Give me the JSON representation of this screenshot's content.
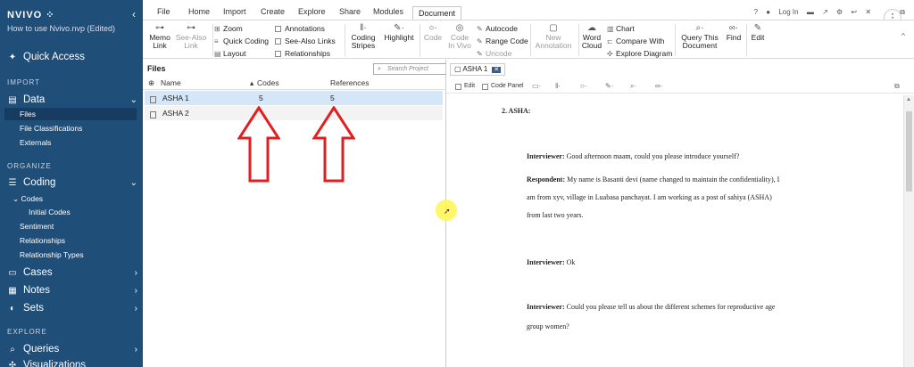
{
  "sidebar": {
    "brand": "NVIVO",
    "file_name": "How to use Nvivo.nvp (Edited)",
    "quick_access": "Quick Access",
    "sections": {
      "import": "IMPORT",
      "organize": "ORGANIZE",
      "explore": "EXPLORE"
    },
    "data_label": "Data",
    "data_items": [
      "Files",
      "File Classifications",
      "Externals"
    ],
    "coding_label": "Coding",
    "codes_label": "Codes",
    "initial_codes": "Initial Codes",
    "coding_items": [
      "Sentiment",
      "Relationships",
      "Relationship Types"
    ],
    "cases_label": "Cases",
    "notes_label": "Notes",
    "sets_label": "Sets",
    "queries_label": "Queries",
    "visualizations_label": "Visualizations"
  },
  "ribbon": {
    "tabs": [
      "File",
      "Home",
      "Import",
      "Create",
      "Explore",
      "Share",
      "Modules",
      "Document"
    ],
    "active_tab": "Document",
    "login": "Log In",
    "memo_link": [
      "Memo",
      "Link"
    ],
    "see_also_link": [
      "See-Also",
      "Link"
    ],
    "zoom": "Zoom",
    "quick_coding": "Quick Coding",
    "layout": "Layout",
    "annotations": "Annotations",
    "see_also_links": "See-Also Links",
    "relationships": "Relationships",
    "coding_stripes": [
      "Coding",
      "Stripes"
    ],
    "highlight": "Highlight",
    "code": "Code",
    "code_in_vivo": [
      "Code",
      "In Vivo"
    ],
    "autocode": "Autocode",
    "range_code": "Range Code",
    "uncode": "Uncode",
    "new_annotation": [
      "New",
      "Annotation"
    ],
    "word_cloud": [
      "Word",
      "Cloud"
    ],
    "chart": "Chart",
    "compare_with": "Compare With",
    "explore_diagram": "Explore Diagram",
    "query_this_document": [
      "Query This",
      "Document"
    ],
    "find": "Find",
    "edit": "Edit"
  },
  "files_panel": {
    "title": "Files",
    "search_placeholder": "Search Project",
    "columns": {
      "name": "Name",
      "codes": "Codes",
      "references": "References"
    },
    "rows": [
      {
        "name": "ASHA 1",
        "codes": "5",
        "references": "5"
      },
      {
        "name": "ASHA 2",
        "codes": "",
        "references": ""
      }
    ]
  },
  "document": {
    "tab_label": "ASHA 1",
    "toolbar": {
      "edit": "Edit",
      "code_panel": "Code Panel"
    },
    "heading": "2. ASHA:",
    "lines": [
      {
        "speaker": "Interviewer:",
        "text": " Good afternoon maam, could you please introduce yourself?"
      },
      {
        "speaker": "Respondent:",
        "text": " My name is Basanti devi (name changed to maintain the confidentiality), I"
      },
      {
        "speaker": "",
        "text": "am from xyv, village in Luabasa panchayat. I am working as a post of sahiya (ASHA)"
      },
      {
        "speaker": "",
        "text": "from last two years."
      },
      {
        "speaker": "Interviewer:",
        "text": " Ok"
      },
      {
        "speaker": "Interviewer:",
        "text": " Could you please tell us about the different schemes for reproductive age"
      },
      {
        "speaker": "",
        "text": "group women?"
      }
    ]
  },
  "colors": {
    "sidebar": "#1f4e79",
    "selected_row": "#d4e6f7",
    "arrow": "#e02020",
    "cursor_highlight": "#fff550"
  }
}
